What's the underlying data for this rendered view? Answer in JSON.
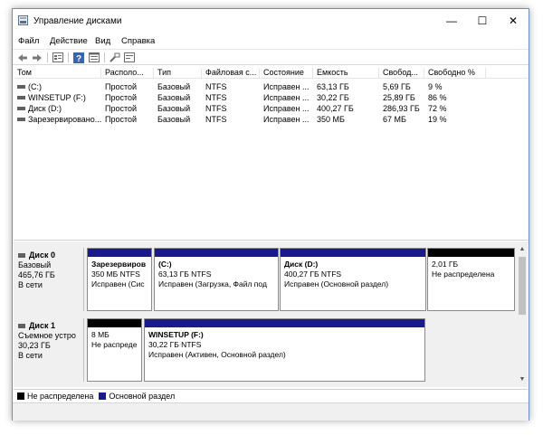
{
  "window": {
    "title": "Управление дисками",
    "controls": {
      "minimize": "—",
      "maximize": "☐",
      "close": "✕"
    }
  },
  "menu": [
    "Файл",
    "Действие",
    "Вид",
    "Справка"
  ],
  "toolbar": {
    "icons": [
      "back-arrow-icon",
      "forward-arrow-icon",
      "properties-icon",
      "help-icon",
      "console-tree-icon",
      "settings-icon",
      "refresh-icon"
    ]
  },
  "volumes": {
    "columns": [
      "Том",
      "Располо...",
      "Тип",
      "Файловая с...",
      "Состояние",
      "Емкость",
      "Свобод...",
      "Свободно %"
    ],
    "rows": [
      [
        "(C:)",
        "Простой",
        "Базовый",
        "NTFS",
        "Исправен ...",
        "63,13 ГБ",
        "5,69 ГБ",
        "9 %"
      ],
      [
        "WINSETUP (F:)",
        "Простой",
        "Базовый",
        "NTFS",
        "Исправен ...",
        "30,22 ГБ",
        "25,89 ГБ",
        "86 %"
      ],
      [
        "Диск (D:)",
        "Простой",
        "Базовый",
        "NTFS",
        "Исправен ...",
        "400,27 ГБ",
        "286,93 ГБ",
        "72 %"
      ],
      [
        "Зарезервировано...",
        "Простой",
        "Базовый",
        "NTFS",
        "Исправен ...",
        "350 МБ",
        "67 МБ",
        "19 %"
      ]
    ]
  },
  "disks": [
    {
      "name": "Диск 0",
      "type": "Базовый",
      "size": "465,76 ГБ",
      "status": "В сети",
      "partitions": [
        {
          "name": "Зарезервиров",
          "detail": "350 МБ NTFS",
          "status": "Исправен (Сис"
        },
        {
          "name": "(C:)",
          "detail": "63,13 ГБ NTFS",
          "status": "Исправен (Загрузка, Файл под"
        },
        {
          "name": "Диск (D:)",
          "detail": "400,27 ГБ NTFS",
          "status": "Исправен (Основной раздел)"
        },
        {
          "name": "",
          "detail": "2,01 ГБ",
          "status": "Не распределена"
        }
      ]
    },
    {
      "name": "Диск 1",
      "type": "Съемное устро",
      "size": "30,23 ГБ",
      "status": "В сети",
      "partitions": [
        {
          "name": "",
          "detail": "8 МБ",
          "status": "Не распреде"
        },
        {
          "name": "WINSETUP (F:)",
          "detail": "30,22 ГБ NTFS",
          "status": "Исправен (Активен, Основной раздел)"
        }
      ]
    }
  ],
  "legend": {
    "unallocated": "Не распределена",
    "primary": "Основной раздел"
  },
  "colors": {
    "primary_partition": "#1a1a8c",
    "unallocated": "#000000"
  }
}
